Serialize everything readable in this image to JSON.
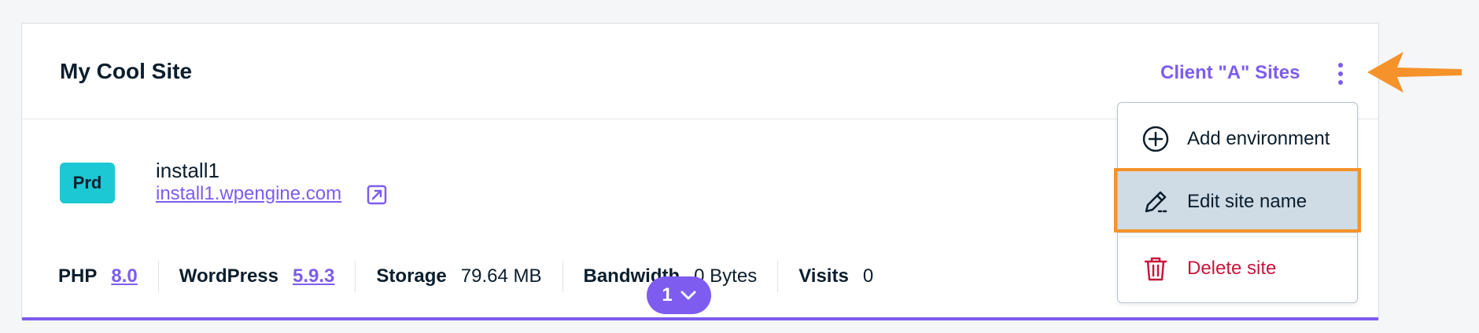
{
  "site": {
    "title": "My Cool Site",
    "group_link": "Client \"A\" Sites"
  },
  "install": {
    "badge": "Prd",
    "name": "install1",
    "url": "install1.wpengine.com"
  },
  "stats": [
    {
      "label": "PHP",
      "value": "8.0"
    },
    {
      "label": "WordPress",
      "value": "5.9.3"
    },
    {
      "label": "Storage",
      "value": "79.64 MB"
    },
    {
      "label": "Bandwidth",
      "value": "0 Bytes"
    },
    {
      "label": "Visits",
      "value": "0"
    }
  ],
  "expand": {
    "count": "1"
  },
  "menu": {
    "items": [
      {
        "label": "Add environment",
        "icon": "plus-circle-icon"
      },
      {
        "label": "Edit site name",
        "icon": "pencil-icon"
      },
      {
        "label": "Delete site",
        "icon": "trash-icon"
      }
    ]
  },
  "colors": {
    "accent": "#7e5cef",
    "badge": "#1cc8d4",
    "danger": "#c8163a",
    "annotation": "#f5922a",
    "menu_selected": "#cfdbe5"
  }
}
